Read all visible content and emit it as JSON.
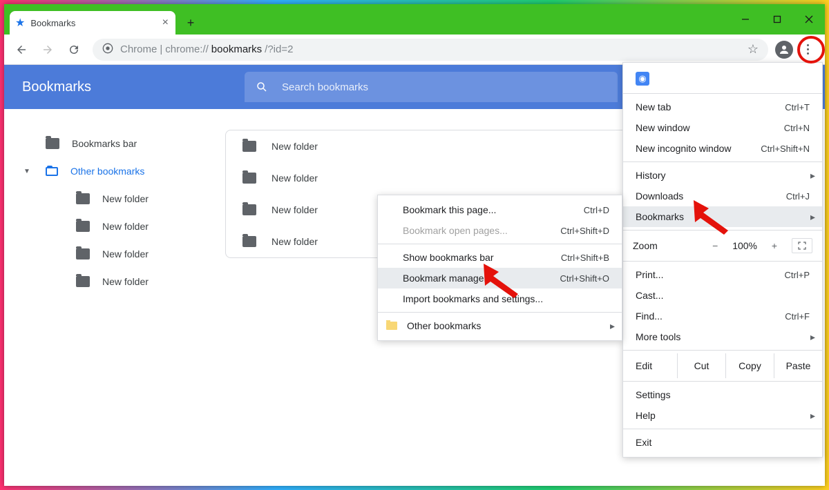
{
  "tab": {
    "title": "Bookmarks"
  },
  "url": {
    "scheme": "Chrome",
    "sep": "|",
    "host": "chrome://",
    "path_bold": "bookmarks",
    "path_rest": "/?id=2"
  },
  "header": {
    "title": "Bookmarks",
    "search_placeholder": "Search bookmarks"
  },
  "sidebar": {
    "items": [
      {
        "label": "Bookmarks bar"
      },
      {
        "label": "Other bookmarks"
      },
      {
        "label": "New folder"
      },
      {
        "label": "New folder"
      },
      {
        "label": "New folder"
      },
      {
        "label": "New folder"
      }
    ]
  },
  "list": {
    "rows": [
      {
        "label": "New folder"
      },
      {
        "label": "New folder"
      },
      {
        "label": "New folder"
      },
      {
        "label": "New folder"
      }
    ]
  },
  "main_menu": {
    "new_tab": {
      "label": "New tab",
      "shortcut": "Ctrl+T"
    },
    "new_window": {
      "label": "New window",
      "shortcut": "Ctrl+N"
    },
    "incognito": {
      "label": "New incognito window",
      "shortcut": "Ctrl+Shift+N"
    },
    "history": {
      "label": "History"
    },
    "downloads": {
      "label": "Downloads",
      "shortcut": "Ctrl+J"
    },
    "bookmarks": {
      "label": "Bookmarks"
    },
    "zoom": {
      "label": "Zoom",
      "value": "100%"
    },
    "print": {
      "label": "Print...",
      "shortcut": "Ctrl+P"
    },
    "cast": {
      "label": "Cast..."
    },
    "find": {
      "label": "Find...",
      "shortcut": "Ctrl+F"
    },
    "more_tools": {
      "label": "More tools"
    },
    "edit": {
      "label": "Edit",
      "cut": "Cut",
      "copy": "Copy",
      "paste": "Paste"
    },
    "settings": {
      "label": "Settings"
    },
    "help": {
      "label": "Help"
    },
    "exit": {
      "label": "Exit"
    }
  },
  "sub_menu": {
    "bookmark_page": {
      "label": "Bookmark this page...",
      "shortcut": "Ctrl+D"
    },
    "bookmark_open": {
      "label": "Bookmark open pages...",
      "shortcut": "Ctrl+Shift+D"
    },
    "show_bar": {
      "label": "Show bookmarks bar",
      "shortcut": "Ctrl+Shift+B"
    },
    "manager": {
      "label": "Bookmark manager",
      "shortcut": "Ctrl+Shift+O"
    },
    "import": {
      "label": "Import bookmarks and settings..."
    },
    "other": {
      "label": "Other bookmarks"
    }
  }
}
